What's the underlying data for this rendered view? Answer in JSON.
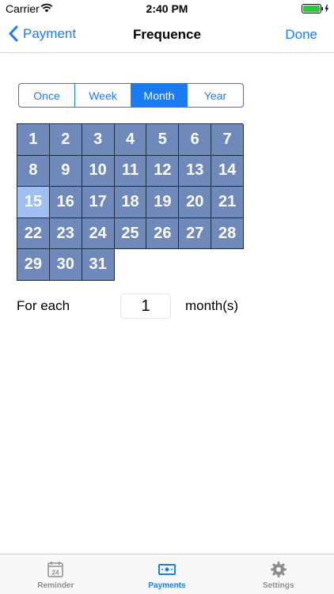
{
  "status": {
    "carrier": "Carrier",
    "time": "2:40 PM"
  },
  "nav": {
    "back_label": "Payment",
    "title": "Frequence",
    "done_label": "Done"
  },
  "segments": [
    "Once",
    "Week",
    "Month",
    "Year"
  ],
  "selected_segment": "Month",
  "days": [
    "1",
    "2",
    "3",
    "4",
    "5",
    "6",
    "7",
    "8",
    "9",
    "10",
    "11",
    "12",
    "13",
    "14",
    "15",
    "16",
    "17",
    "18",
    "19",
    "20",
    "21",
    "22",
    "23",
    "24",
    "25",
    "26",
    "27",
    "28",
    "29",
    "30",
    "31"
  ],
  "selected_day": "15",
  "interval": {
    "prefix": "For each",
    "value": "1",
    "unit": "month(s)"
  },
  "tabs": [
    {
      "label": "Reminder",
      "icon": "calendar-icon",
      "calendar_number": "24"
    },
    {
      "label": "Payments",
      "icon": "money-icon"
    },
    {
      "label": "Settings",
      "icon": "gear-icon"
    }
  ],
  "active_tab": "Payments",
  "colors": {
    "accent": "#1a7cf0",
    "day_cell": "#6f89ba",
    "day_selected": "#9fbff0",
    "grid_line": "#1e2c44"
  }
}
